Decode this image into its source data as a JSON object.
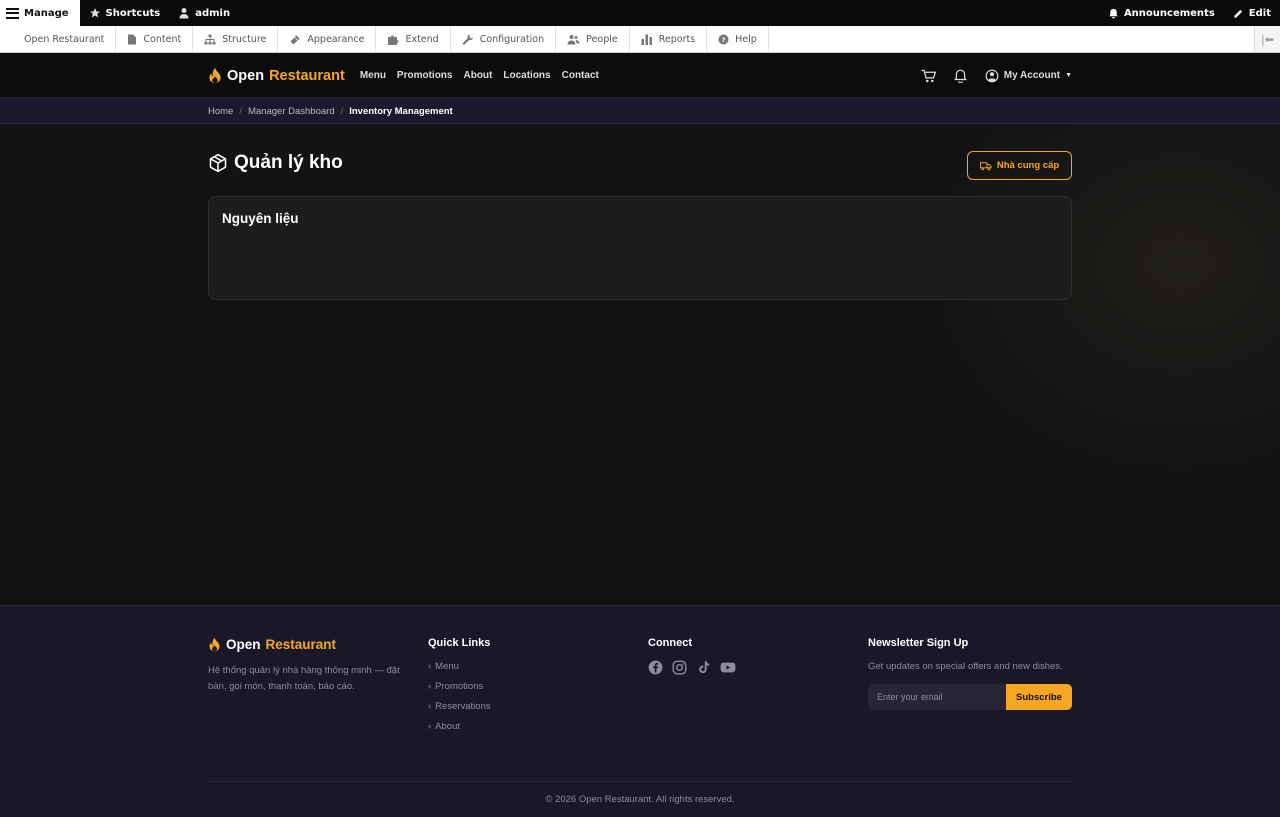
{
  "admin_toolbar": {
    "manage_label": "Manage",
    "shortcuts_label": "Shortcuts",
    "user_label": "admin",
    "announcements_label": "Announcements",
    "edit_label": "Edit",
    "tray_items": [
      {
        "label": "Open Restaurant",
        "icon": "none"
      },
      {
        "label": "Content",
        "icon": "file-icon"
      },
      {
        "label": "Structure",
        "icon": "sitemap-icon"
      },
      {
        "label": "Appearance",
        "icon": "paintbrush-icon"
      },
      {
        "label": "Extend",
        "icon": "puzzle-icon"
      },
      {
        "label": "Configuration",
        "icon": "wrench-icon"
      },
      {
        "label": "People",
        "icon": "people-icon"
      },
      {
        "label": "Reports",
        "icon": "bar-chart-icon"
      },
      {
        "label": "Help",
        "icon": "help-icon"
      }
    ]
  },
  "header": {
    "brand_first": "Open",
    "brand_second": "Restaurant",
    "nav": [
      "Menu",
      "Promotions",
      "About",
      "Locations",
      "Contact"
    ],
    "account_label": "My Account"
  },
  "breadcrumb": {
    "items": [
      "Home",
      "Manager Dashboard"
    ],
    "current": "Inventory Management"
  },
  "main": {
    "title": "Quản lý kho",
    "supplier_button": "Nhà cung cấp",
    "card_title": "Nguyên liệu"
  },
  "footer": {
    "brand_first": "Open",
    "brand_second": "Restaurant",
    "description": "Hệ thống quản lý nhà hàng thông minh — đặt bàn, gọi món, thanh toán, báo cáo.",
    "quick_links_heading": "Quick Links",
    "quick_links": [
      "Menu",
      "Promotions",
      "Reservations",
      "About"
    ],
    "connect_heading": "Connect",
    "socials": [
      "facebook-icon",
      "instagram-icon",
      "tiktok-icon",
      "youtube-icon"
    ],
    "newsletter_heading": "Newsletter Sign Up",
    "newsletter_desc": "Get updates on special offers and new dishes.",
    "email_placeholder": "Enter your email",
    "subscribe_label": "Subscribe",
    "copyright": "© 2026 Open Restaurant. All rights reserved."
  },
  "colors": {
    "accent": "#f5a623",
    "background": "#131313",
    "footer_bg": "#1a1828"
  }
}
